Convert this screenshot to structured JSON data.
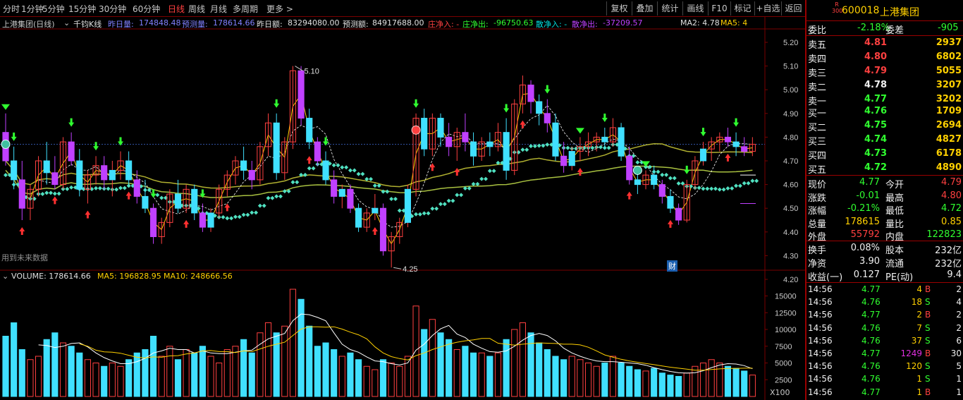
{
  "toolbar": {
    "periods": [
      "分时",
      "1分钟",
      "5分钟",
      "15分钟",
      "30分钟",
      "60分钟",
      "日线",
      "周线",
      "月线",
      "多周期",
      "更多 >"
    ],
    "active": "日线",
    "right_buttons": [
      "复权",
      "叠加",
      "统计",
      "画线",
      "F10",
      "标记",
      "+自选",
      "返回"
    ]
  },
  "infobar": {
    "stock": "上港集团(日线)",
    "indicator": "千钧K线",
    "prev_vol_label": "昨日量:",
    "prev_vol": "174848.48",
    "pred_vol_label": "预测量:",
    "pred_vol": "178614.66",
    "prev_amt_label": "昨日额:",
    "prev_amt": "83294080.00",
    "pred_amt_label": "预测额:",
    "pred_amt": "84917688.00",
    "zhuang_in": "庄净入: -",
    "zhuang_out": "庄净出:",
    "zhuang_out_val": "-96750.63",
    "san_in": "散净入: -",
    "san_out": "散净出:",
    "san_out_val": "-37209.57",
    "ma2": "MA2: 4.78",
    "ma5": "MA5: 4"
  },
  "chart_data": {
    "type": "candlestick",
    "price_axis": [
      "5.20",
      "5.10",
      "5.00",
      "4.90",
      "4.80",
      "4.70",
      "4.60",
      "4.50",
      "4.40",
      "4.30",
      "4.20"
    ],
    "ylim": [
      4.2,
      5.2
    ],
    "high_label": "5.10",
    "low_label": "4.25",
    "future_note": "用到未来数据",
    "cai_badge": "财",
    "volume": {
      "label": "VOLUME: 178614.66",
      "ma5": "MA5: 196828.95",
      "ma10": "MA10: 248666.56",
      "axis": [
        "15000",
        "12500",
        "10000",
        "7500",
        "5000",
        "2500"
      ],
      "ylim": [
        0,
        16000
      ],
      "unit": "X100"
    },
    "candles": [
      [
        4.82,
        4.9,
        4.68,
        4.7
      ],
      [
        4.7,
        4.76,
        4.58,
        4.62
      ],
      [
        4.62,
        4.7,
        4.45,
        4.5
      ],
      [
        4.5,
        4.6,
        4.45,
        4.58
      ],
      [
        4.58,
        4.72,
        4.55,
        4.7
      ],
      [
        4.7,
        4.78,
        4.6,
        4.65
      ],
      [
        4.65,
        4.72,
        4.58,
        4.6
      ],
      [
        4.6,
        4.8,
        4.58,
        4.78
      ],
      [
        4.78,
        4.82,
        4.68,
        4.7
      ],
      [
        4.7,
        4.75,
        4.55,
        4.58
      ],
      [
        4.58,
        4.66,
        4.52,
        4.64
      ],
      [
        4.64,
        4.72,
        4.6,
        4.68
      ],
      [
        4.68,
        4.72,
        4.58,
        4.62
      ],
      [
        4.62,
        4.7,
        4.55,
        4.66
      ],
      [
        4.66,
        4.74,
        4.62,
        4.7
      ],
      [
        4.7,
        4.74,
        4.6,
        4.62
      ],
      [
        4.62,
        4.66,
        4.52,
        4.55
      ],
      [
        4.55,
        4.62,
        4.48,
        4.5
      ],
      [
        4.5,
        4.52,
        4.35,
        4.38
      ],
      [
        4.38,
        4.46,
        4.35,
        4.44
      ],
      [
        4.44,
        4.58,
        4.42,
        4.56
      ],
      [
        4.56,
        4.62,
        4.48,
        4.5
      ],
      [
        4.5,
        4.6,
        4.48,
        4.58
      ],
      [
        4.58,
        4.6,
        4.45,
        4.48
      ],
      [
        4.48,
        4.52,
        4.4,
        4.42
      ],
      [
        4.42,
        4.5,
        4.4,
        4.48
      ],
      [
        4.48,
        4.6,
        4.46,
        4.58
      ],
      [
        4.58,
        4.66,
        4.55,
        4.64
      ],
      [
        4.64,
        4.72,
        4.6,
        4.7
      ],
      [
        4.7,
        4.76,
        4.62,
        4.66
      ],
      [
        4.66,
        4.7,
        4.58,
        4.62
      ],
      [
        4.62,
        4.78,
        4.6,
        4.76
      ],
      [
        4.76,
        4.9,
        4.72,
        4.86
      ],
      [
        4.86,
        4.9,
        4.62,
        4.65
      ],
      [
        4.65,
        4.8,
        4.62,
        4.78
      ],
      [
        4.78,
        5.1,
        4.75,
        5.08
      ],
      [
        5.08,
        5.1,
        4.85,
        4.88
      ],
      [
        4.88,
        4.92,
        4.75,
        4.78
      ],
      [
        4.78,
        4.8,
        4.68,
        4.7
      ],
      [
        4.7,
        4.74,
        4.6,
        4.62
      ],
      [
        4.62,
        4.66,
        4.52,
        4.55
      ],
      [
        4.55,
        4.6,
        4.5,
        4.58
      ],
      [
        4.58,
        4.6,
        4.48,
        4.5
      ],
      [
        4.5,
        4.52,
        4.4,
        4.42
      ],
      [
        4.42,
        4.5,
        4.4,
        4.48
      ],
      [
        4.48,
        4.56,
        4.45,
        4.5
      ],
      [
        4.5,
        4.52,
        4.3,
        4.32
      ],
      [
        4.32,
        4.4,
        4.25,
        4.38
      ],
      [
        4.38,
        4.46,
        4.35,
        4.44
      ],
      [
        4.44,
        4.6,
        4.42,
        4.58
      ],
      [
        4.58,
        4.9,
        4.55,
        4.88
      ],
      [
        4.88,
        4.92,
        4.72,
        4.75
      ],
      [
        4.75,
        4.9,
        4.72,
        4.88
      ],
      [
        4.88,
        4.9,
        4.76,
        4.8
      ],
      [
        4.8,
        4.86,
        4.72,
        4.76
      ],
      [
        4.76,
        4.84,
        4.7,
        4.82
      ],
      [
        4.82,
        4.9,
        4.74,
        4.78
      ],
      [
        4.78,
        4.82,
        4.68,
        4.72
      ],
      [
        4.72,
        4.8,
        4.7,
        4.78
      ],
      [
        4.78,
        4.82,
        4.72,
        4.76
      ],
      [
        4.76,
        4.86,
        4.74,
        4.82
      ],
      [
        4.82,
        4.88,
        4.62,
        4.66
      ],
      [
        4.66,
        4.96,
        4.64,
        4.94
      ],
      [
        4.94,
        5.06,
        4.9,
        5.02
      ],
      [
        5.02,
        5.04,
        4.9,
        4.95
      ],
      [
        4.95,
        4.98,
        4.85,
        4.9
      ],
      [
        4.9,
        4.96,
        4.82,
        4.86
      ],
      [
        4.86,
        4.9,
        4.7,
        4.72
      ],
      [
        4.72,
        4.78,
        4.65,
        4.68
      ],
      [
        4.68,
        4.76,
        4.66,
        4.74
      ],
      [
        4.74,
        4.8,
        4.7,
        4.76
      ],
      [
        4.76,
        4.82,
        4.72,
        4.78
      ],
      [
        4.78,
        4.82,
        4.74,
        4.8
      ],
      [
        4.8,
        4.84,
        4.75,
        4.78
      ],
      [
        4.78,
        4.88,
        4.76,
        4.84
      ],
      [
        4.84,
        4.86,
        4.7,
        4.72
      ],
      [
        4.72,
        4.76,
        4.6,
        4.62
      ],
      [
        4.62,
        4.66,
        4.56,
        4.6
      ],
      [
        4.6,
        4.66,
        4.58,
        4.64
      ],
      [
        4.64,
        4.68,
        4.58,
        4.6
      ],
      [
        4.6,
        4.62,
        4.52,
        4.55
      ],
      [
        4.55,
        4.58,
        4.48,
        4.5
      ],
      [
        4.5,
        4.52,
        4.43,
        4.45
      ],
      [
        4.45,
        4.62,
        4.44,
        4.6
      ],
      [
        4.6,
        4.72,
        4.58,
        4.7
      ],
      [
        4.7,
        4.78,
        4.68,
        4.75
      ],
      [
        4.75,
        4.8,
        4.7,
        4.78
      ],
      [
        4.78,
        4.82,
        4.74,
        4.8
      ],
      [
        4.8,
        4.84,
        4.76,
        4.78
      ],
      [
        4.78,
        4.82,
        4.72,
        4.76
      ],
      [
        4.76,
        4.8,
        4.72,
        4.74
      ],
      [
        4.74,
        4.8,
        4.72,
        4.77
      ]
    ],
    "volumes": [
      9000,
      11000,
      7000,
      5500,
      6000,
      8500,
      9500,
      8000,
      7500,
      6500,
      5500,
      5000,
      4500,
      5000,
      4500,
      5500,
      6500,
      7000,
      9000,
      6000,
      7500,
      5500,
      7000,
      6500,
      7500,
      6000,
      5000,
      7000,
      7500,
      8500,
      6500,
      9500,
      11000,
      9500,
      10500,
      16000,
      14500,
      10500,
      7500,
      8000,
      7000,
      6000,
      6500,
      5500,
      4500,
      4000,
      5500,
      5000,
      4500,
      6000,
      13500,
      10000,
      11500,
      9500,
      8500,
      7000,
      7500,
      6500,
      6500,
      6000,
      6500,
      8500,
      10000,
      11000,
      9500,
      8000,
      7000,
      6000,
      5500,
      6000,
      5500,
      5000,
      4500,
      5000,
      6000,
      5000,
      4500,
      4000,
      3800,
      4200,
      3500,
      3200,
      3000,
      3500,
      4500,
      5000,
      5500,
      5000,
      4500,
      4200,
      3800,
      3200
    ]
  },
  "quote": {
    "tag": "R 300",
    "code": "600018",
    "name": "上港集团",
    "weibi_label": "委比",
    "weibi": "-2.18%",
    "weicha_label": "委差",
    "weicha": "-905",
    "sells": [
      {
        "label": "卖五",
        "price": "4.81",
        "vol": "2937"
      },
      {
        "label": "卖四",
        "price": "4.80",
        "vol": "6802"
      },
      {
        "label": "卖三",
        "price": "4.79",
        "vol": "5055"
      },
      {
        "label": "卖二",
        "price": "4.78",
        "vol": "3207"
      },
      {
        "label": "卖一",
        "price": "4.77",
        "vol": "3202"
      }
    ],
    "buys": [
      {
        "label": "买一",
        "price": "4.76",
        "vol": "1709"
      },
      {
        "label": "买二",
        "price": "4.75",
        "vol": "2694"
      },
      {
        "label": "买三",
        "price": "4.74",
        "vol": "4827"
      },
      {
        "label": "买四",
        "price": "4.73",
        "vol": "6178"
      },
      {
        "label": "买五",
        "price": "4.72",
        "vol": "4890"
      }
    ],
    "stats": [
      {
        "l1": "现价",
        "v1": "4.77",
        "l2": "今开",
        "v2": "4.79"
      },
      {
        "l1": "涨跌",
        "v1": "-0.01",
        "l2": "最高",
        "v2": "4.80"
      },
      {
        "l1": "涨幅",
        "v1": "-0.21%",
        "l2": "最低",
        "v2": "4.72"
      },
      {
        "l1": "总量",
        "v1": "178615",
        "l2": "量比",
        "v2": "0.85"
      },
      {
        "l1": "外盘",
        "v1": "55792",
        "l2": "内盘",
        "v2": "122823"
      }
    ],
    "fund": [
      {
        "l1": "换手",
        "v1": "0.08%",
        "l2": "股本",
        "v2": "232亿"
      },
      {
        "l1": "净资",
        "v1": "3.90",
        "l2": "流通",
        "v2": "232亿"
      },
      {
        "l1": "收益(一)",
        "v1": "0.127",
        "l2": "PE(动)",
        "v2": "9.4"
      }
    ],
    "ticks": [
      {
        "t": "14:56",
        "p": "4.77",
        "v": "4",
        "s": "B",
        "n": "2"
      },
      {
        "t": "14:56",
        "p": "4.76",
        "v": "18",
        "s": "S",
        "n": "4"
      },
      {
        "t": "14:56",
        "p": "4.77",
        "v": "2",
        "s": "B",
        "n": "2"
      },
      {
        "t": "14:56",
        "p": "4.76",
        "v": "7",
        "s": "S",
        "n": "2"
      },
      {
        "t": "14:56",
        "p": "4.76",
        "v": "37",
        "s": "S",
        "n": "6"
      },
      {
        "t": "14:56",
        "p": "4.77",
        "v": "1249",
        "s": "B",
        "n": "30"
      },
      {
        "t": "14:56",
        "p": "4.76",
        "v": "120",
        "s": "S",
        "n": "5"
      },
      {
        "t": "14:56",
        "p": "4.76",
        "v": "1",
        "s": "S",
        "n": "1"
      },
      {
        "t": "14:56",
        "p": "4.77",
        "v": "1",
        "s": "B",
        "n": "1"
      }
    ]
  },
  "colors": {
    "up": "#ff4040",
    "down": "#30ff30",
    "cyan": "#40e0ff",
    "magenta": "#c040ff",
    "ma_yellow": "#c8c832",
    "teal_dots": "#50e0c0",
    "grid": "#7a0000"
  }
}
